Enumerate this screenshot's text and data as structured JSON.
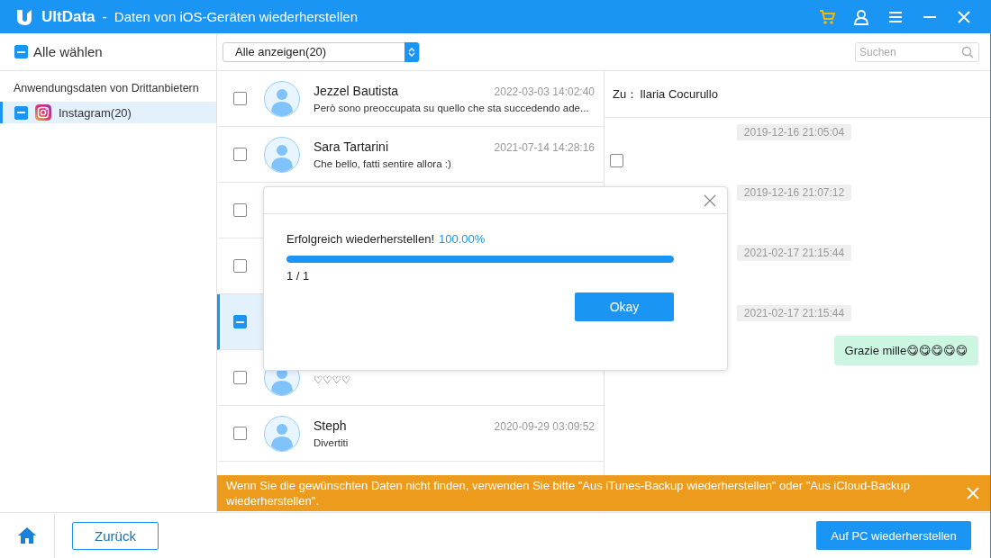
{
  "window": {
    "app_name": "UltData",
    "separator": "-",
    "title": "Daten von iOS-Geräten wiederherstellen"
  },
  "sidebar": {
    "select_all": {
      "label": "Alle wählen",
      "checked": true
    },
    "section": "Anwendungsdaten von Drittanbietern",
    "items": [
      {
        "label": "Instagram(20)",
        "checked": true,
        "selected": true
      }
    ]
  },
  "toolbar": {
    "filter": "Alle anzeigen(20)",
    "search": {
      "placeholder": "Suchen"
    }
  },
  "conversations": [
    {
      "name": "Jezzel Bautista",
      "date": "2022-03-03 14:02:40",
      "preview": "Però sono preoccupata su quello che sta succedendo ade...",
      "checked": false,
      "selected": false
    },
    {
      "name": "Sara Tartarini",
      "date": "2021-07-14 14:28:16",
      "preview": "Che bello, fatti sentire allora :)",
      "checked": false,
      "selected": false
    },
    {
      "checked": false,
      "selected": false
    },
    {
      "checked": false,
      "selected": false
    },
    {
      "checked": true,
      "selected": true
    },
    {
      "preview": "♡♡♡♡",
      "checked": false,
      "selected": false
    },
    {
      "name": "Steph",
      "date": "2020-09-29 03:09:52",
      "preview": "Divertiti",
      "checked": false,
      "selected": false
    }
  ],
  "chat": {
    "recipient_label": "Zu：",
    "recipient": "Ilaria Cocurullo",
    "items": [
      {
        "kind": "time",
        "text": "2019-12-16 21:05:04"
      },
      {
        "kind": "incoming",
        "checked": false
      },
      {
        "kind": "time",
        "text": "2019-12-16 21:07:12"
      },
      {
        "kind": "time",
        "text": "2021-02-17 21:15:44"
      },
      {
        "kind": "time",
        "text": "2021-02-17 21:15:44"
      },
      {
        "kind": "outgoing",
        "text": "Grazie mille😋😋😋😋😋"
      }
    ]
  },
  "banner": {
    "text": "Wenn Sie die gewünschten Daten nicht finden, verwenden Sie bitte \"Aus iTunes-Backup wiederherstellen\" oder \"Aus iCloud-Backup wiederherstellen\"."
  },
  "dialog": {
    "message": "Erfolgreich wiederherstellen!",
    "percent": "100.00%",
    "level": 1,
    "count": "1 / 1",
    "button": "Okay"
  },
  "footer": {
    "back": "Zurück",
    "recover": "Auf PC wiederherstellen"
  }
}
